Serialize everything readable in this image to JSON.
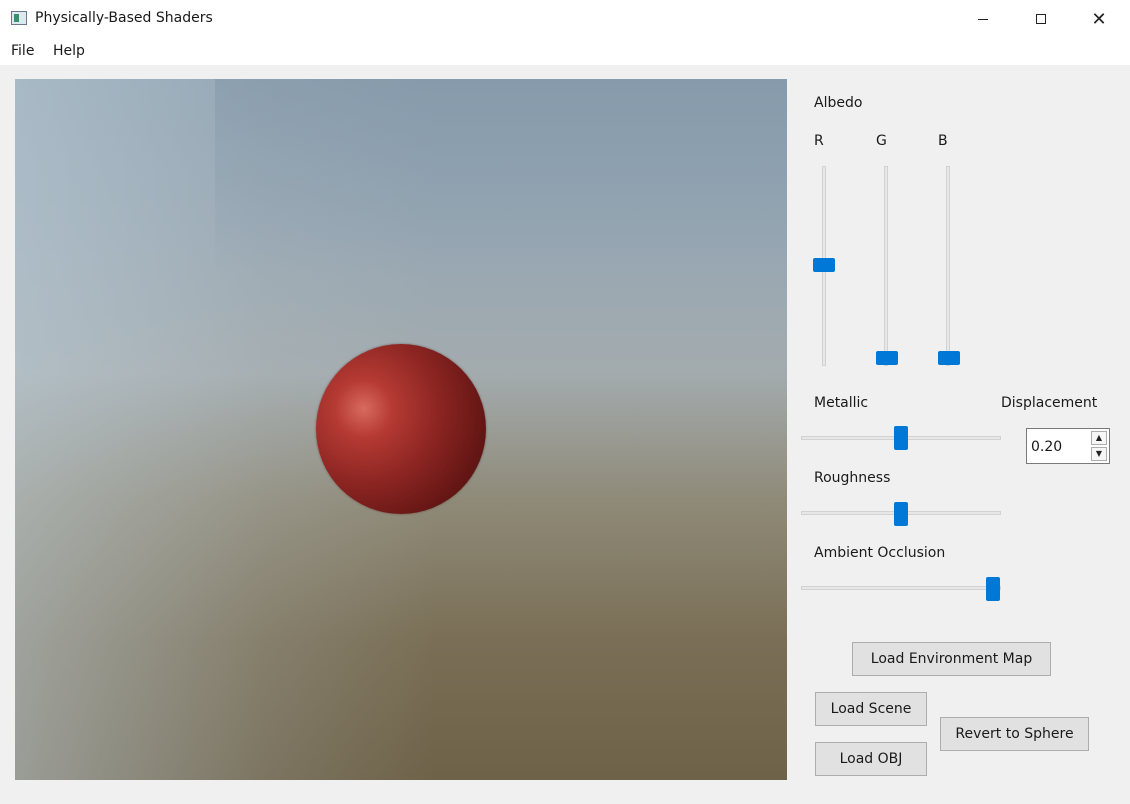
{
  "window": {
    "title": "Physically-Based Shaders",
    "controls": {
      "minimize": "minimize-icon",
      "maximize": "maximize-icon",
      "close": "✕"
    }
  },
  "menu": {
    "file": "File",
    "help": "Help"
  },
  "viewport": {
    "subject": "sphere",
    "sphere_color": "#8e2623"
  },
  "albedo": {
    "title": "Albedo",
    "channels": [
      {
        "label": "R",
        "value_fraction": 0.5
      },
      {
        "label": "G",
        "value_fraction": 0.0
      },
      {
        "label": "B",
        "value_fraction": 0.0
      }
    ]
  },
  "metallic": {
    "label": "Metallic",
    "value_fraction": 0.5
  },
  "displacement": {
    "label": "Displacement",
    "value": "0.20",
    "up": "▲",
    "down": "▼"
  },
  "roughness": {
    "label": "Roughness",
    "value_fraction": 0.5
  },
  "ambient_occlusion": {
    "label": "Ambient Occlusion",
    "value_fraction": 1.0
  },
  "buttons": {
    "load_env_map": "Load Environment Map",
    "load_scene": "Load Scene",
    "load_obj": "Load OBJ",
    "revert_sphere": "Revert to Sphere"
  },
  "colors": {
    "accent": "#0078d7",
    "background": "#f0f0f0"
  }
}
